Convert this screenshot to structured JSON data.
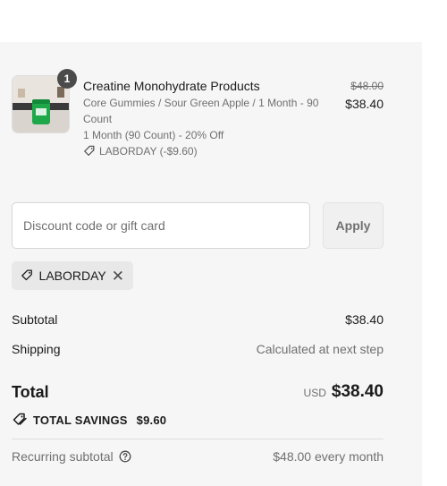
{
  "line_item": {
    "quantity": "1",
    "title": "Creatine Monohydrate Products",
    "variant": "Core Gummies / Sour Green Apple / 1 Month - 90 Count",
    "plan": "1 Month (90 Count) - 20% Off",
    "discount": "LABORDAY (-$9.60)",
    "original_price": "$48.00",
    "price": "$38.40",
    "thumbnail_icon": "product-image"
  },
  "discount_form": {
    "placeholder": "Discount code or gift card",
    "apply_label": "Apply"
  },
  "applied_code": {
    "code": "LABORDAY"
  },
  "summary": {
    "subtotal_label": "Subtotal",
    "subtotal_value": "$38.40",
    "shipping_label": "Shipping",
    "shipping_value": "Calculated at next step",
    "total_label": "Total",
    "currency": "USD",
    "total_value": "$38.40",
    "savings_label": "TOTAL SAVINGS",
    "savings_value": "$9.60",
    "recurring_label": "Recurring subtotal",
    "recurring_value": "$48.00 every month"
  },
  "colors": {
    "panel_bg": "#f6f6f6",
    "text": "#1a1a1a",
    "muted": "#707070",
    "badge": "#4b4b4b",
    "product_green": "#1fa84a"
  }
}
